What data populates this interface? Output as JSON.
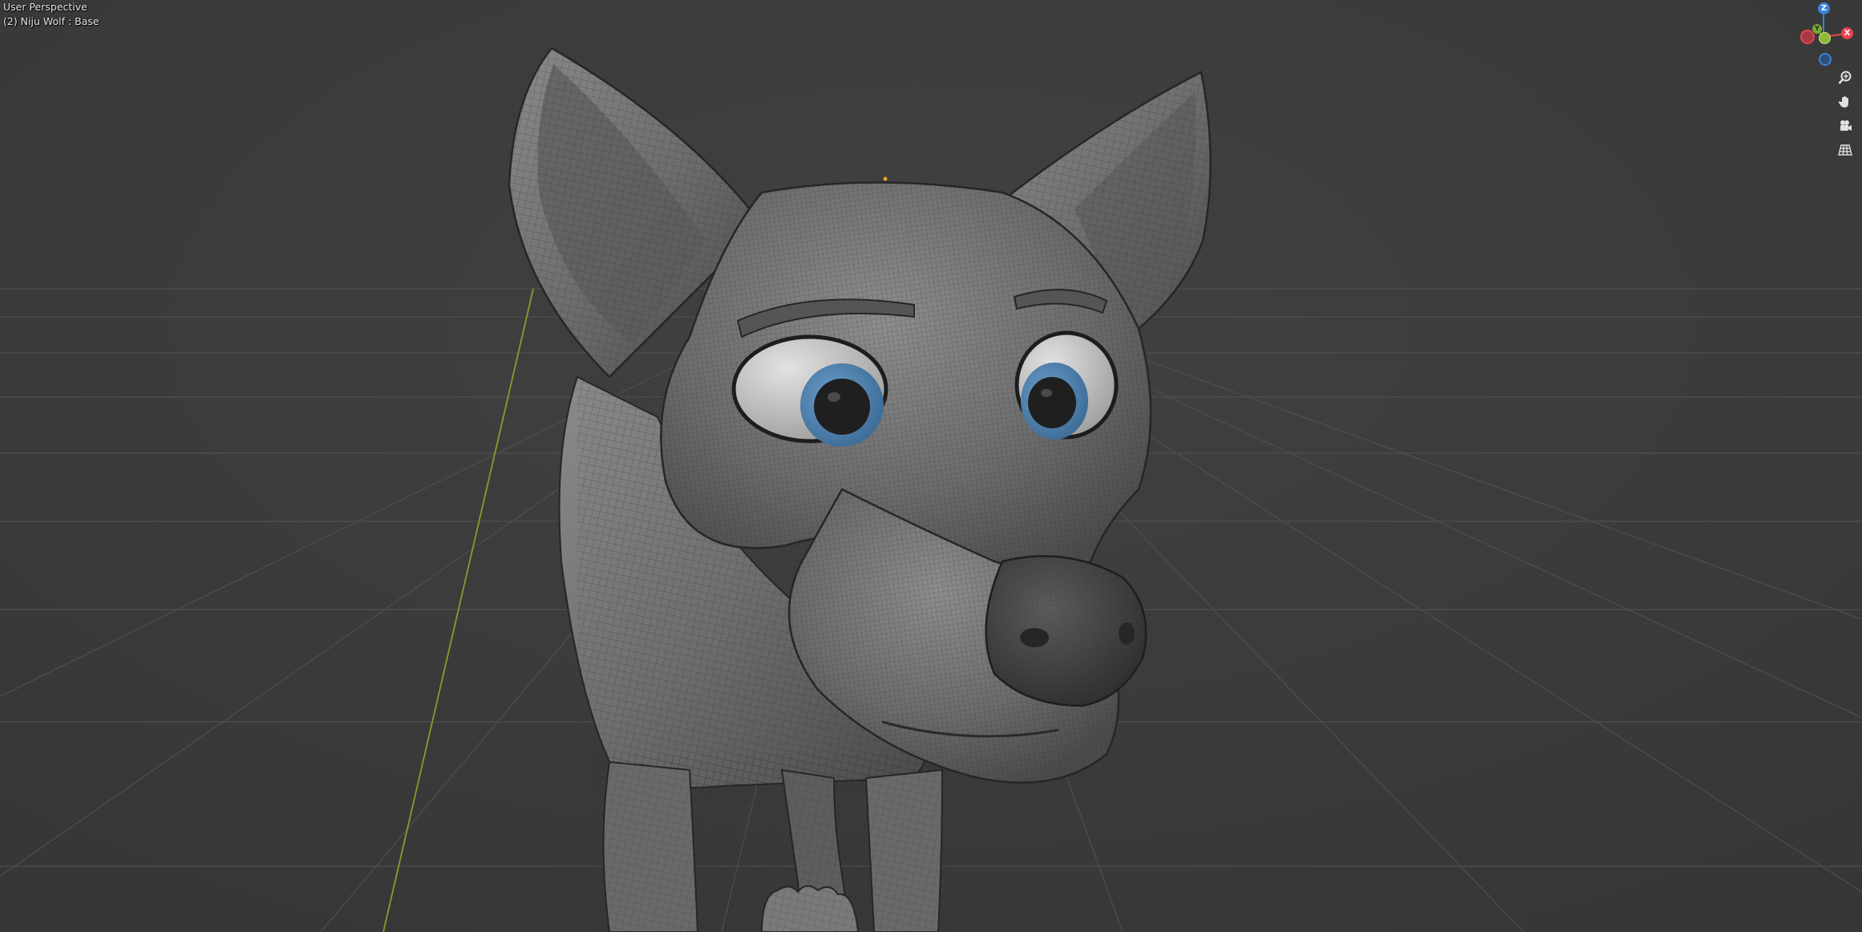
{
  "viewport": {
    "view_name": "User Perspective",
    "object_info": "(2) Niju Wolf : Base"
  },
  "nav_gizmo": {
    "z_label": "Z",
    "y_label": "Y",
    "x_label": "X",
    "colors": {
      "x": "#e8424f",
      "y": "#7aa82c",
      "z": "#3b82d6"
    }
  },
  "nav_buttons": [
    {
      "icon": "zoom-icon"
    },
    {
      "icon": "hand-pan-icon"
    },
    {
      "icon": "camera-icon"
    },
    {
      "icon": "grid-perspective-icon"
    }
  ]
}
